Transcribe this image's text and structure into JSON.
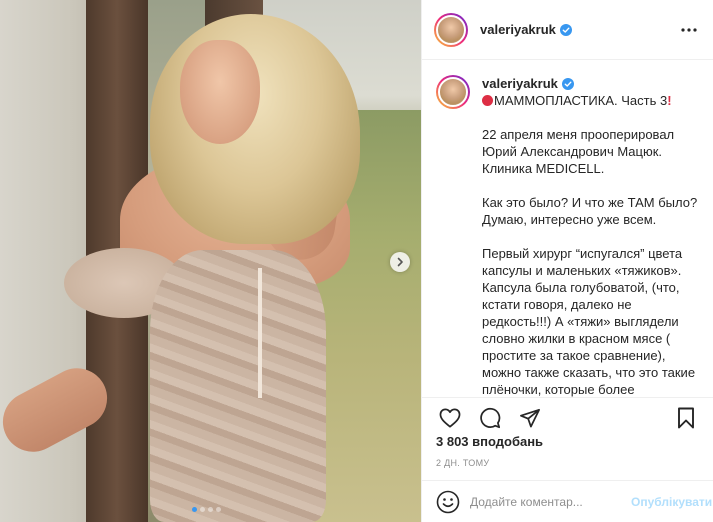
{
  "header": {
    "username": "valeriyakruk",
    "verified_icon": "verified-badge-icon",
    "more_icon": "more-options-icon"
  },
  "caption": {
    "username": "valeriyakruk",
    "title": "МАММОПЛАСТИКА. Часть 3",
    "title_emoji_start": "red-circle-emoji",
    "title_emoji_end": "exclamation-emoji",
    "paragraphs": [
      "22 апреля меня прооперировал Юрий Александрович Мацюк. Клиника MEDICELL.",
      "Как это было? И что же ТАМ было? Думаю, интересно уже всем.",
      "Первый хирург “испугался” цвета капсулы и маленьких «тяжиков». Капсула была голубоватой, (что, кстати говоря, далеко не редкость!!!) А «тяжи» выглядели словно жилки в красном мясе ( простите за такое сравнение), можно также сказать, что это такие плёночки, которые более рельефно выделены на самой капсуле. Так видимо мой организм"
    ]
  },
  "carousel": {
    "next_icon": "chevron-right-icon",
    "slide_count": 4,
    "active_index": 0
  },
  "actions": {
    "like_icon": "heart-icon",
    "comment_icon": "comment-icon",
    "share_icon": "share-icon",
    "save_icon": "bookmark-icon"
  },
  "likes": "3 803 вподобань",
  "timestamp": "2 дн. тому",
  "comment": {
    "emoji_icon": "smiley-icon",
    "placeholder": "Додайте коментар...",
    "post_label": "Опублікувати"
  },
  "colors": {
    "accent": "#3897f0",
    "post_disabled": "#b2dffc",
    "muted": "#8e8e8e",
    "text": "#262626"
  }
}
